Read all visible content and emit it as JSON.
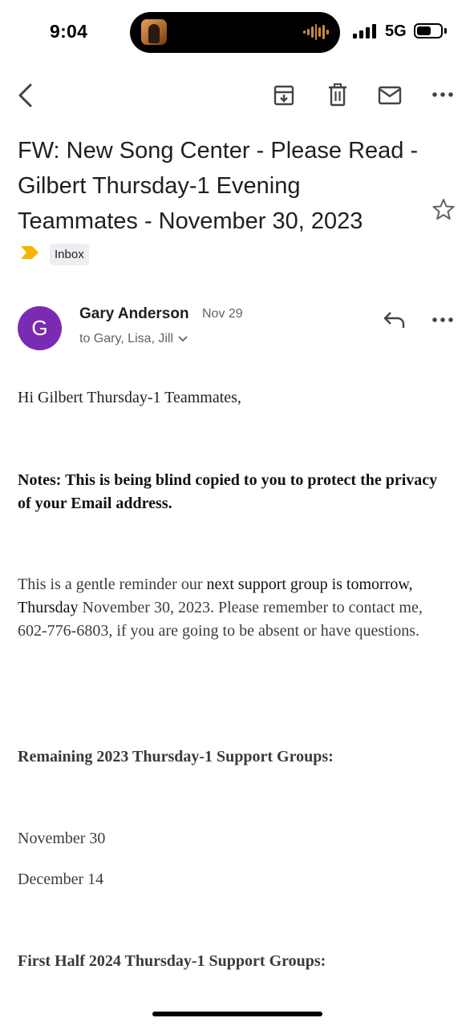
{
  "status_bar": {
    "time": "9:04",
    "network": "5G",
    "icons": [
      "signal-bars-icon",
      "battery-icon",
      "audio-waveform-icon"
    ]
  },
  "toolbar": {
    "icons": [
      "back-arrow-icon",
      "archive-icon",
      "delete-icon",
      "mark-unread-icon",
      "more-options-icon"
    ]
  },
  "email": {
    "subject": "FW: New Song Center - Please Read - Gilbert Thursday-1 Evening Teammates - November 30, 2023",
    "label": "Inbox",
    "importance_color": "#f4b400",
    "sender": {
      "initial": "G",
      "name": "Gary Anderson",
      "date": "Nov 29",
      "recipients": "to Gary, Lisa, Jill",
      "avatar_color": "#7b2bb3"
    },
    "body": {
      "greeting": "Hi Gilbert Thursday-1 Teammates,",
      "notes": "Notes: This is being blind copied to you to protect the privacy of your Email address.",
      "para_part1": "This is a gentle reminder our ",
      "para_part2": "next support group is tomorrow, Thursday",
      "para_part3": " November 30, 2023. Please remember to contact me, 602-776-6803, if you are going to be absent or have questions.",
      "heading_remaining": "Remaining 2023 Thursday-1 Support Groups:",
      "dates": [
        "November 30",
        "December 14"
      ],
      "heading_first_half": "First Half 2024 Thursday-1 Support Groups:"
    }
  }
}
